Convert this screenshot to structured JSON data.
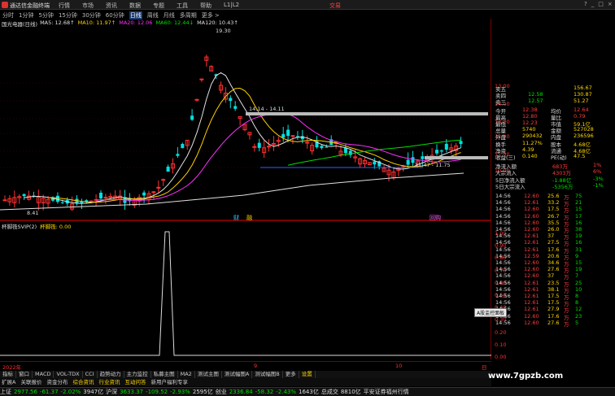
{
  "titlebar": {
    "app": "通达信金融终端",
    "menu": [
      "行情",
      "市场",
      "资讯",
      "数据",
      "专题",
      "工具",
      "帮助",
      "L1|L2"
    ],
    "trade": "交易",
    "winbtns": [
      "?",
      "_",
      "□",
      "×"
    ]
  },
  "periods": {
    "items": [
      "分时",
      "1分钟",
      "5分钟",
      "15分钟",
      "30分钟",
      "60分钟",
      "日线",
      "周线",
      "月线",
      "多周期",
      "更多 >"
    ],
    "active": "日线"
  },
  "main": {
    "stock": "国光电器(日线)",
    "ma": [
      {
        "t": "MA5: 12.68↑",
        "c": "#e0e0e0"
      },
      {
        "t": "MA10: 11.97↑",
        "c": "#ffd000"
      },
      {
        "t": "MA20: 12.06",
        "c": "#ff30ff"
      },
      {
        "t": "MA60: 12.44↓",
        "c": "#00e000"
      },
      {
        "t": "MA120: 10.43↑",
        "c": "#e0e0e0"
      }
    ],
    "price_labels": [
      "13.00",
      "14.00",
      "13.00",
      "12.00",
      "11.00",
      "10.00"
    ],
    "annotations": {
      "high": "19.30",
      "low": "8.41",
      "box1": "14.14 - 14.11",
      "box2": "11.47 - 11.75"
    },
    "event_labels": [
      "财",
      "融",
      "回购"
    ]
  },
  "sub": {
    "title": "杯脚筏SVIP(2)",
    "value": "杯脚筏: 0.00",
    "axis": [
      "1.00",
      "0.90",
      "0.80",
      "0.70",
      "0.60",
      "0.50",
      "0.40",
      "0.30",
      "0.20",
      "0.10",
      "0.00"
    ]
  },
  "date_axis": [
    "2022年",
    "9",
    "10",
    "日"
  ],
  "tabs": [
    "指标",
    "窗口",
    "MACD",
    "VOL-TDX",
    "CCI",
    "趋势动力",
    "主力监控",
    "私募主图",
    "MA2",
    "测试主图",
    "测试幅图A",
    "测试幅图B",
    "更多",
    "设置"
  ],
  "status1": [
    "扩展A",
    "关联报价",
    "资金分布",
    "综合资讯",
    "行业资讯",
    "互动问答",
    "新用户福利专享"
  ],
  "status2": [
    {
      "t": "上证",
      "c": "wht"
    },
    {
      "t": "2977.56",
      "c": "grn"
    },
    {
      "t": "-61.37",
      "c": "grn"
    },
    {
      "t": "-2.02%",
      "c": "grn"
    },
    {
      "t": "3947亿",
      "c": "wht"
    },
    {
      "t": "沪深",
      "c": "wht"
    },
    {
      "t": "3633.37",
      "c": "grn"
    },
    {
      "t": "-109.52",
      "c": "grn"
    },
    {
      "t": "-2.93%",
      "c": "grn"
    },
    {
      "t": "2595亿",
      "c": "wht"
    },
    {
      "t": "创业",
      "c": "wht"
    },
    {
      "t": "2336.84",
      "c": "grn"
    },
    {
      "t": "-58.32",
      "c": "grn"
    },
    {
      "t": "-2.43%",
      "c": "grn"
    },
    {
      "t": "1643亿",
      "c": "wht"
    },
    {
      "t": "总成交",
      "c": "wht"
    },
    {
      "t": "8810亿",
      "c": "wht"
    },
    {
      "t": "平安证券福州行情",
      "c": "wht"
    }
  ],
  "quote": [
    {
      "k": "卖五",
      "p": "",
      "v": "156.67"
    },
    {
      "k": "卖四",
      "p": "12.58",
      "v": "130.87"
    },
    {
      "k": "卖三",
      "p": "12.57",
      "v": "51.27"
    },
    {
      "k": "今开",
      "p": "12.38",
      "k2": "均价",
      "p2": "12.64"
    },
    {
      "k": "最高",
      "p": "12.80",
      "k2": "量比",
      "p2": "0.79"
    },
    {
      "k": "最低",
      "p": "12.23",
      "k2": "市值",
      "p2": "59.1亿"
    },
    {
      "k": "总量",
      "p": "5740",
      "k2": "金额",
      "p2": "527028"
    },
    {
      "k": "外盘",
      "p": "290432",
      "k2": "内盘",
      "p2": "236596"
    },
    {
      "k": "换手",
      "p": "11.27%",
      "k2": "股本",
      "p2": "4.68亿"
    },
    {
      "k": "净资",
      "p": "4.39",
      "k2": "流通",
      "p2": "4.68亿"
    },
    {
      "k": "收益(三)",
      "p": "0.140",
      "k2": "PE(动)",
      "p2": "47.5"
    }
  ],
  "flow": [
    {
      "k": "净流入额",
      "v": "683万",
      "p": "1%"
    },
    {
      "k": "大宗流入",
      "v": "4303万",
      "p": "6%"
    },
    {
      "k": "5日净流入额",
      "v": "-1.88亿",
      "p": "-3%"
    },
    {
      "k": "5日大宗流入",
      "v": "-5356万",
      "p": "-1%"
    }
  ],
  "ticks": [
    [
      "14:56",
      "12.60",
      "25.6",
      "万",
      "75"
    ],
    [
      "14:56",
      "12.61",
      "33.2",
      "万",
      "21"
    ],
    [
      "14:56",
      "12.60",
      "17.5",
      "万",
      "15"
    ],
    [
      "14:56",
      "12.60",
      "26.7",
      "万",
      "17"
    ],
    [
      "14:56",
      "12.60",
      "35.5",
      "万",
      "16"
    ],
    [
      "14:56",
      "12.60",
      "26.0",
      "万",
      "38"
    ],
    [
      "14:56",
      "12.61",
      "37",
      "万",
      "19"
    ],
    [
      "14:56",
      "12.61",
      "27.5",
      "万",
      "16"
    ],
    [
      "14:56",
      "12.61",
      "17.6",
      "万",
      "31"
    ],
    [
      "14:56",
      "12.59",
      "20.6",
      "万",
      "9"
    ],
    [
      "14:56",
      "12.60",
      "34.6",
      "万",
      "15"
    ],
    [
      "14:56",
      "12.60",
      "27.6",
      "万",
      "19"
    ],
    [
      "14:56",
      "12.60",
      "37",
      "万",
      "7"
    ],
    [
      "14:56",
      "12.61",
      "23.5",
      "万",
      "25"
    ],
    [
      "14:56",
      "12.61",
      "38.1",
      "万",
      "10"
    ],
    [
      "14:56",
      "12.61",
      "17.5",
      "万",
      "8"
    ],
    [
      "14:56",
      "12.61",
      "17.5",
      "万",
      "8"
    ],
    [
      "14:56",
      "12.61",
      "27.9",
      "万",
      "12"
    ],
    [
      "14:56",
      "12.60",
      "17.6",
      "万",
      "23"
    ],
    [
      "14:56",
      "12.60",
      "27.6",
      "万",
      "5"
    ]
  ],
  "hint": "A股监控面板",
  "watermark": "www.7gpzb.com"
}
